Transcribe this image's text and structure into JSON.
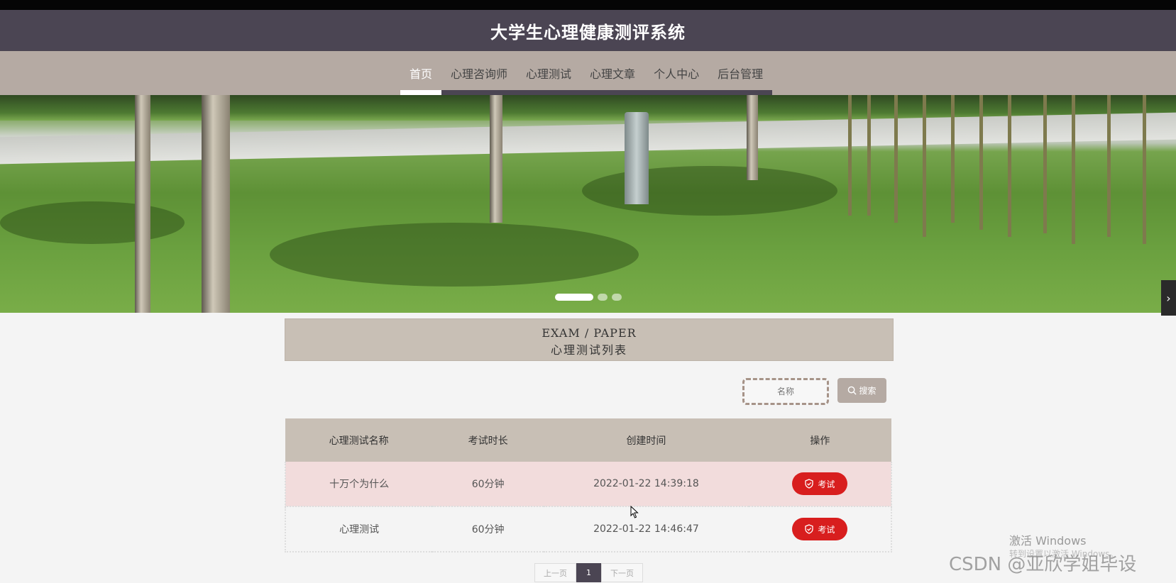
{
  "site_title": "大学生心理健康测评系统",
  "nav": {
    "items": [
      {
        "label": "首页",
        "active": true
      },
      {
        "label": "心理咨询师",
        "active": false
      },
      {
        "label": "心理测试",
        "active": false
      },
      {
        "label": "心理文章",
        "active": false
      },
      {
        "label": "个人中心",
        "active": false
      },
      {
        "label": "后台管理",
        "active": false
      }
    ]
  },
  "banner": {
    "slides": 3,
    "active_slide": 1,
    "next_icon": "chevron-right-icon"
  },
  "section": {
    "en_title": "EXAM / PAPER",
    "cn_title": "心理测试列表"
  },
  "search": {
    "placeholder": "名称",
    "button_label": "搜索",
    "button_icon": "search-icon"
  },
  "table": {
    "headers": [
      "心理测试名称",
      "考试时长",
      "创建时间",
      "操作"
    ],
    "rows": [
      {
        "name": "十万个为什么",
        "duration": "60分钟",
        "created": "2022-01-22 14:39:18",
        "action": "考试"
      },
      {
        "name": "心理测试",
        "duration": "60分钟",
        "created": "2022-01-22 14:46:47",
        "action": "考试"
      }
    ]
  },
  "pagination": {
    "prev": "上一页",
    "current": "1",
    "next": "下一页"
  },
  "watermarks": {
    "activate": "激活 Windows",
    "activate_sub": "转到设置以激活 Windows。",
    "csdn": "CSDN @亚欣学姐毕设"
  },
  "colors": {
    "title_bar": "#4b4553",
    "nav_bar": "#b5aaa3",
    "section_bg": "#c8bfb5",
    "exam_button": "#d81e1e",
    "highlight_row": "#f2dcdc"
  }
}
